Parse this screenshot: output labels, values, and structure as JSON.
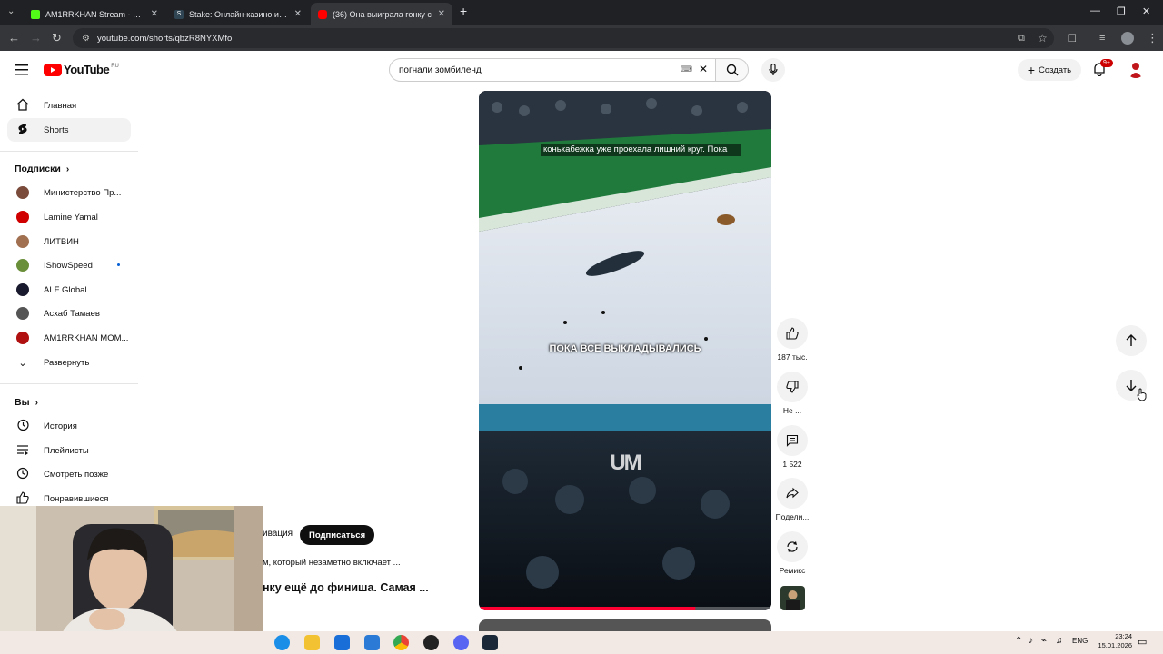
{
  "browser": {
    "tabs": [
      {
        "title": "AM1RRKHAN Stream - Watch L",
        "color": "#53fc18"
      },
      {
        "title": "Stake: Онлайн-казино и ставк",
        "color": "#1a2c38"
      },
      {
        "title": "(36) Она выиграла гонку с",
        "color": "#ff0000"
      }
    ],
    "new_tab": "+",
    "url": "youtube.com/shorts/qbzR8NYXMfo"
  },
  "youtube": {
    "logo_text": "YouTube",
    "logo_region": "RU",
    "search_value": "погнали зомбиленд",
    "create_label": "Создать",
    "notif_badge": "9+"
  },
  "sidebar": {
    "main": [
      {
        "label": "Главная"
      },
      {
        "label": "Shorts"
      }
    ],
    "subs_header": "Подписки",
    "subscriptions": [
      {
        "label": "Министерство Пр...",
        "color": "#7a4a3a"
      },
      {
        "label": "Lamine Yamal",
        "color": "#d00000"
      },
      {
        "label": "ЛИТВИН",
        "color": "#a07050"
      },
      {
        "label": "IShowSpeed",
        "color": "#6a8f3a"
      },
      {
        "label": "ALF Global",
        "color": "#1a1a2e"
      },
      {
        "label": "Асхаб Тамаев",
        "color": "#555555"
      },
      {
        "label": "AM1RRKHAN МОМ...",
        "color": "#b01010"
      }
    ],
    "expand": "Развернуть",
    "you_header": "Вы",
    "you_items": [
      {
        "label": "История"
      },
      {
        "label": "Плейлисты"
      },
      {
        "label": "Смотреть позже"
      },
      {
        "label": "Понравившиеся"
      }
    ]
  },
  "video": {
    "caption_top": "конькабежка уже проехала лишний круг. Пока",
    "caption_mid": "ПОКА ВСЕ ВЫКЛАДЫВАЛИСЬ",
    "watermark": "UM",
    "channel_suffix": "ивация",
    "subscribe": "Подписаться",
    "desc1": "м, который незаметно включает ...",
    "desc2": "нку ещё до финиша. Самая ...",
    "progress": 0.74
  },
  "actions": {
    "likes": "187 тыс.",
    "dislike": "Не ...",
    "comments": "1 522",
    "share": "Подели...",
    "remix": "Ремикс"
  },
  "taskbar": {
    "lang": "ENG",
    "time": "23:24",
    "date": "15.01.2026"
  }
}
